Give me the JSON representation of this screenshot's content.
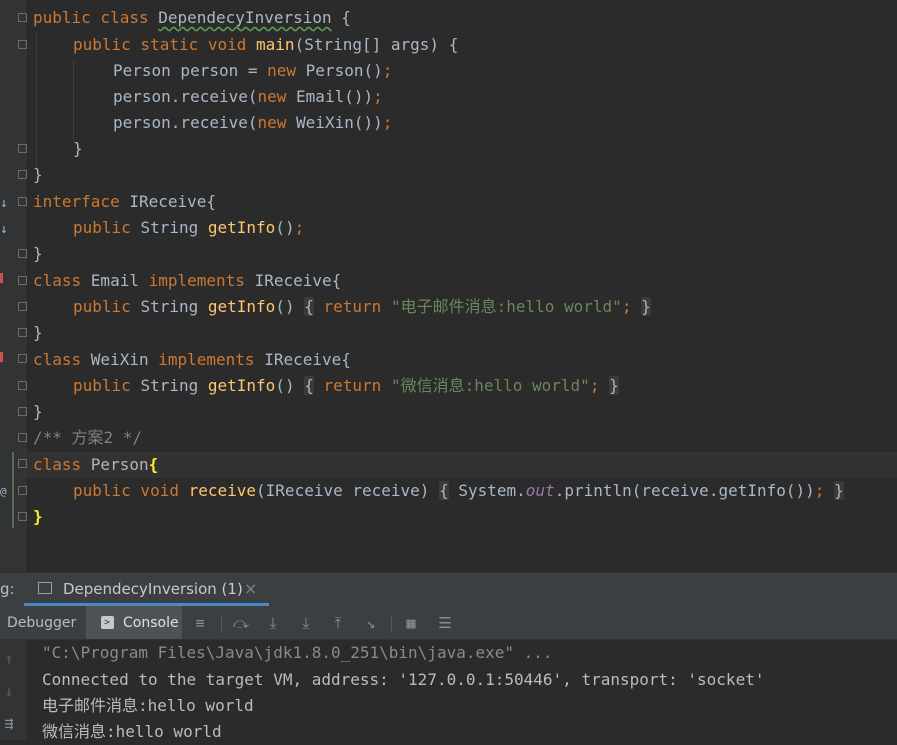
{
  "code_lines": [
    "public class DependecyInversion {",
    "public static void main(String[] args) {",
    "Person person = new Person();",
    "person.receive(new Email());",
    "person.receive(new WeiXin());",
    "}",
    "}",
    "interface IReceive{",
    "public String getInfo();",
    "}",
    "class Email implements IReceive{",
    "public String getInfo() { return \"电子邮件消息:hello world\"; }",
    "}",
    "class WeiXin implements IReceive{",
    "public String getInfo() { return \"微信消息:hello world\"; }",
    "}",
    "/** 方案2 */",
    "class Person{",
    "public void receive(IReceive receive) { System.out.println(receive.getInfo()); }",
    "}"
  ],
  "tool_window": {
    "prefix": "g:",
    "run_tab": "DependecyInversion (1)",
    "close_icon": "×",
    "debugger_tab": "Debugger",
    "console_tab": "Console"
  },
  "console_output": [
    "\"C:\\Program Files\\Java\\jdk1.8.0_251\\bin\\java.exe\" ...",
    "Connected to the target VM, address: '127.0.0.1:50446', transport: 'socket'",
    "电子邮件消息:hello world",
    "微信消息:hello world"
  ],
  "icons": {
    "console_icon": "console-icon",
    "toolbar": [
      "menu-icon",
      "step-over-icon",
      "step-into-icon",
      "force-step-into-icon",
      "step-out-icon",
      "run-to-cursor-icon",
      "evaluate-icon",
      "trace-icon"
    ]
  },
  "colors": {
    "editor_bg": "#2b2b2b",
    "keyword": "#cc7832",
    "function": "#ffc66d",
    "string": "#6a8759",
    "comment": "#808080",
    "text": "#a9b7c6"
  }
}
